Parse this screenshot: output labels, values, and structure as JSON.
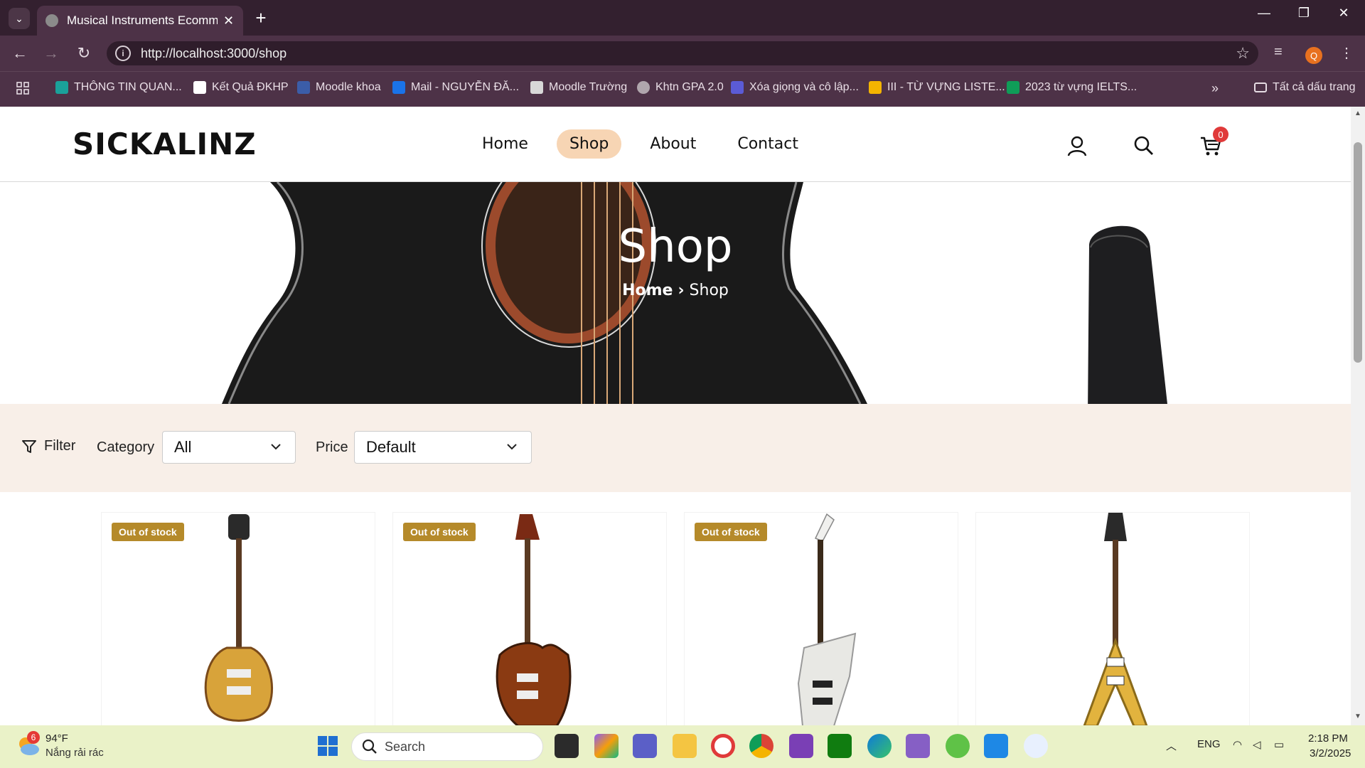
{
  "browser": {
    "tab_title": "Musical Instruments Ecommerce",
    "url": "http://localhost:3000/shop",
    "profile_initial": "Q",
    "bookmarks": [
      "THÔNG TIN QUAN...",
      "Kết Quả ĐKHP",
      "Moodle khoa",
      "Mail - NGUYỄN ĐĂ...",
      "Moodle Trường",
      "Khtn GPA 2.0",
      "Xóa giọng và cô lập...",
      "III - TỪ VỰNG LISTE...",
      "2023 từ vựng IELTS..."
    ],
    "all_bookmarks": "Tất cả dấu trang"
  },
  "site": {
    "logo": "SICKALINZ",
    "nav": [
      "Home",
      "Shop",
      "About",
      "Contact"
    ],
    "active_nav": "Shop",
    "cart_count": "0"
  },
  "hero": {
    "title": "Shop",
    "breadcrumb_home": "Home",
    "breadcrumb_sep": "›",
    "breadcrumb_current": "Shop"
  },
  "filters": {
    "filter_label": "Filter",
    "category_label": "Category",
    "category_value": "All",
    "price_label": "Price",
    "price_value": "Default"
  },
  "products": [
    {
      "badge": "Out of stock",
      "color": "#d8a33a"
    },
    {
      "badge": "Out of stock",
      "color": "#8a3a12"
    },
    {
      "badge": "Out of stock",
      "color": "#e8e8e4"
    },
    {
      "badge": "",
      "color": "#e2b33e"
    }
  ],
  "taskbar": {
    "weather_badge": "6",
    "temperature": "94°F",
    "weather_desc": "Nắng rải rác",
    "search_placeholder": "Search",
    "language": "ENG",
    "time": "2:18 PM",
    "date": "3/2/2025"
  }
}
